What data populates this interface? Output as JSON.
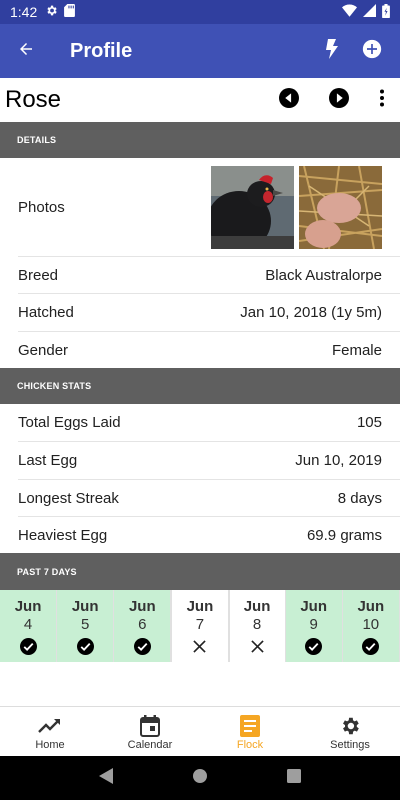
{
  "status_bar": {
    "time": "1:42",
    "icons": [
      "gear-icon",
      "sd-card-icon",
      "wifi-icon",
      "signal-icon",
      "battery-icon"
    ]
  },
  "app_bar": {
    "title": "Profile",
    "icons": [
      "back-arrow-icon",
      "flash-icon",
      "add-circle-icon"
    ],
    "color": "#3f51b5"
  },
  "chicken": {
    "name": "Rose"
  },
  "details": {
    "header": "DETAILS",
    "photos_label": "Photos",
    "rows": [
      {
        "label": "Breed",
        "value": "Black Australorpe"
      },
      {
        "label": "Hatched",
        "value": "Jan 10, 2018 (1y 5m)"
      },
      {
        "label": "Gender",
        "value": "Female"
      }
    ]
  },
  "stats": {
    "header": "CHICKEN STATS",
    "rows": [
      {
        "label": "Total Eggs Laid",
        "value": "105"
      },
      {
        "label": "Last Egg",
        "value": "Jun 10, 2019"
      },
      {
        "label": "Longest Streak",
        "value": "8 days"
      },
      {
        "label": "Heaviest Egg",
        "value": "69.9 grams"
      }
    ]
  },
  "past_days": {
    "header": "PAST 7 DAYS",
    "days": [
      {
        "month": "Jun",
        "day": "4",
        "laid": true
      },
      {
        "month": "Jun",
        "day": "5",
        "laid": true
      },
      {
        "month": "Jun",
        "day": "6",
        "laid": true
      },
      {
        "month": "Jun",
        "day": "7",
        "laid": false
      },
      {
        "month": "Jun",
        "day": "8",
        "laid": false
      },
      {
        "month": "Jun",
        "day": "9",
        "laid": true
      },
      {
        "month": "Jun",
        "day": "10",
        "laid": true
      }
    ],
    "laid_color": "#c8efd3"
  },
  "bottom_nav": {
    "tabs": [
      {
        "label": "Home",
        "icon": "trending-up-icon"
      },
      {
        "label": "Calendar",
        "icon": "calendar-icon"
      },
      {
        "label": "Flock",
        "icon": "document-icon",
        "active": true
      },
      {
        "label": "Settings",
        "icon": "gear-icon"
      }
    ],
    "active_color": "#f5a623"
  }
}
